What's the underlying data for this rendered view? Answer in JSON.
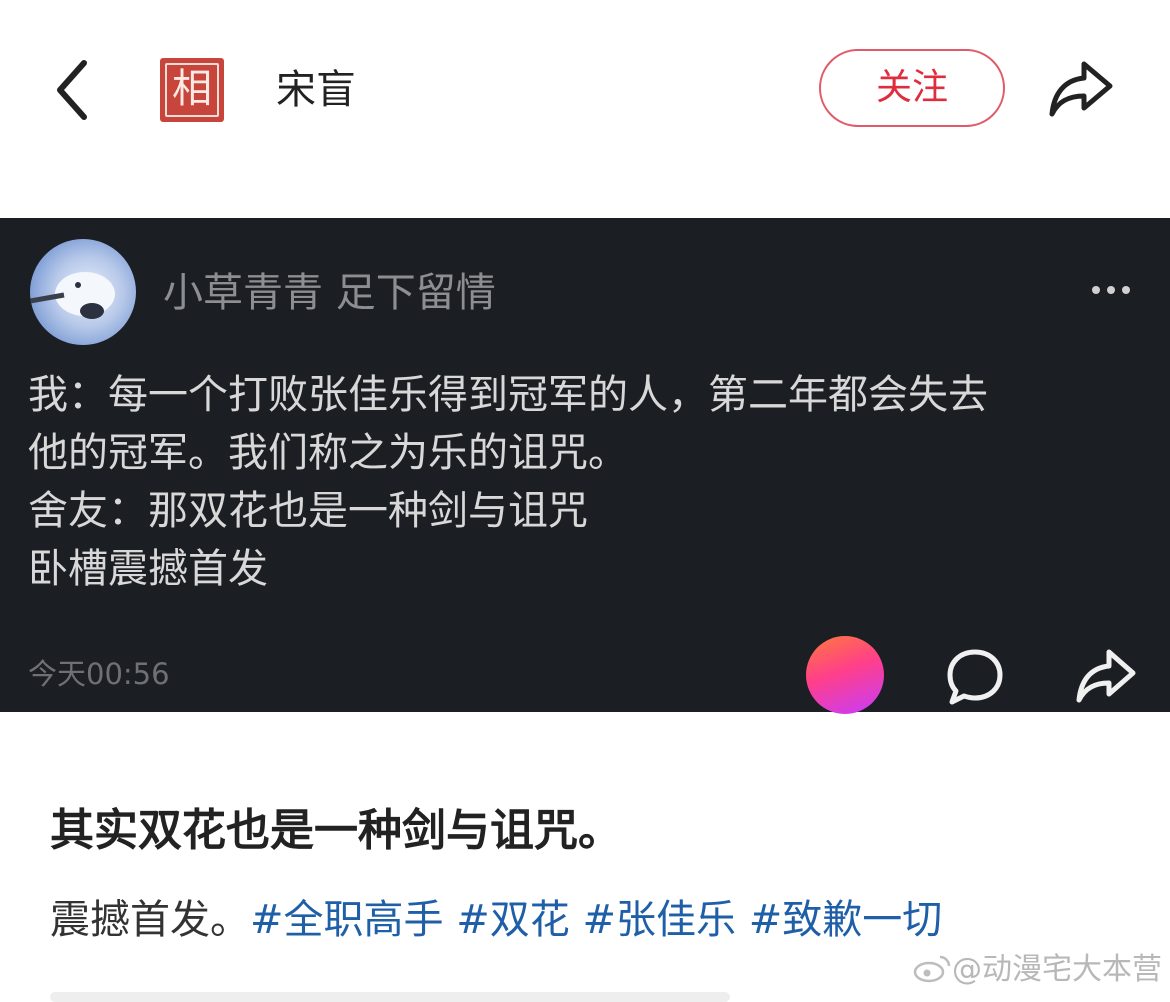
{
  "header": {
    "seal_char": "相",
    "user_name": "宋盲",
    "follow_label": "关注",
    "icons": [
      "chevron-left-icon",
      "share-icon"
    ]
  },
  "post": {
    "commenter_name": "小草青青 足下留情",
    "lines": [
      "我：每一个打败张佳乐得到冠军的人，第二年都会失去",
      "他的冠军。我们称之为乐的诅咒。",
      "舍友：那双花也是一种剑与诅咒",
      "卧槽震撼首发"
    ],
    "time": "今天00:56",
    "icons": [
      "more-icon",
      "emoji-reaction",
      "comment-icon",
      "forward-icon"
    ]
  },
  "caption": {
    "title": "其实双花也是一种剑与诅咒。",
    "body_prefix": "震撼首发。",
    "hashtags": [
      "#全职高手",
      "#双花",
      "#张佳乐",
      "#致歉一切"
    ]
  },
  "watermark": {
    "text": "@动漫宅大本营",
    "icon": "weibo-icon"
  },
  "colors": {
    "accent_red": "#e02d3e",
    "card_background": "#1b1e22",
    "hashtag_blue": "#1f5fa8"
  }
}
